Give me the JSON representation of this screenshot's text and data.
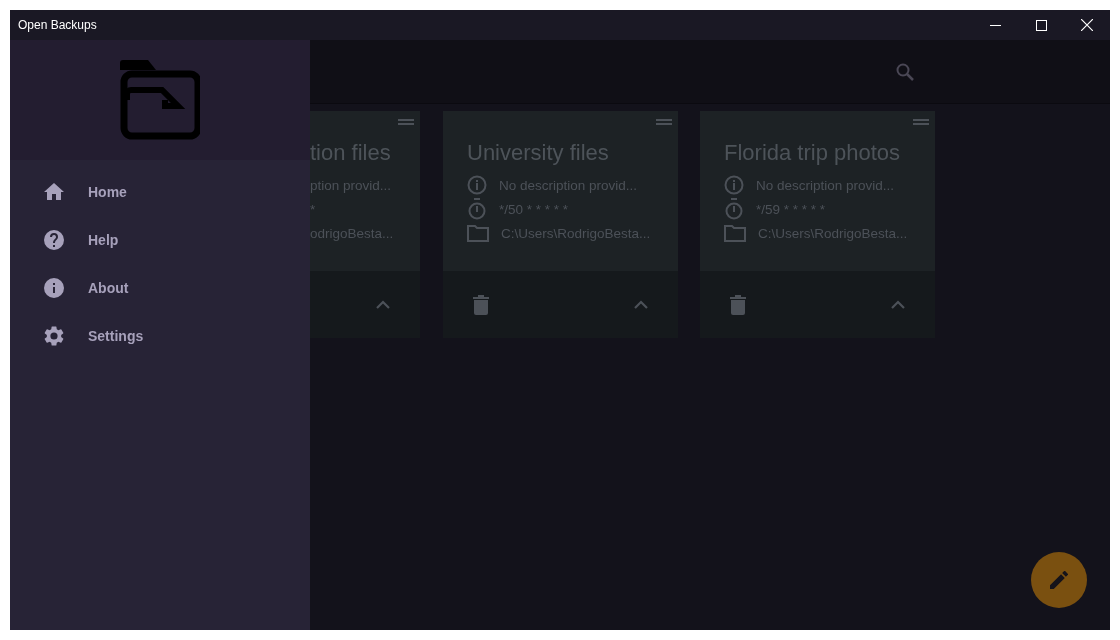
{
  "window": {
    "title": "Open Backups"
  },
  "drawer": {
    "items": [
      {
        "label": "Home",
        "kind": "home"
      },
      {
        "label": "Help",
        "kind": "help"
      },
      {
        "label": "About",
        "kind": "about"
      },
      {
        "label": "Settings",
        "kind": "settings"
      }
    ]
  },
  "cards": [
    {
      "kind": "partial",
      "title": "tion files",
      "description": "ption provid...",
      "schedule": "*",
      "path": "odrigoBesta..."
    },
    {
      "kind": "full",
      "title": "University files",
      "description": "No description provid...",
      "schedule": "*/50 * * * * *",
      "path": "C:\\Users\\RodrigoBesta..."
    },
    {
      "kind": "full",
      "title": "Florida trip photos",
      "description": "No description provid...",
      "schedule": "*/59 * * * * *",
      "path": "C:\\Users\\RodrigoBesta..."
    }
  ]
}
